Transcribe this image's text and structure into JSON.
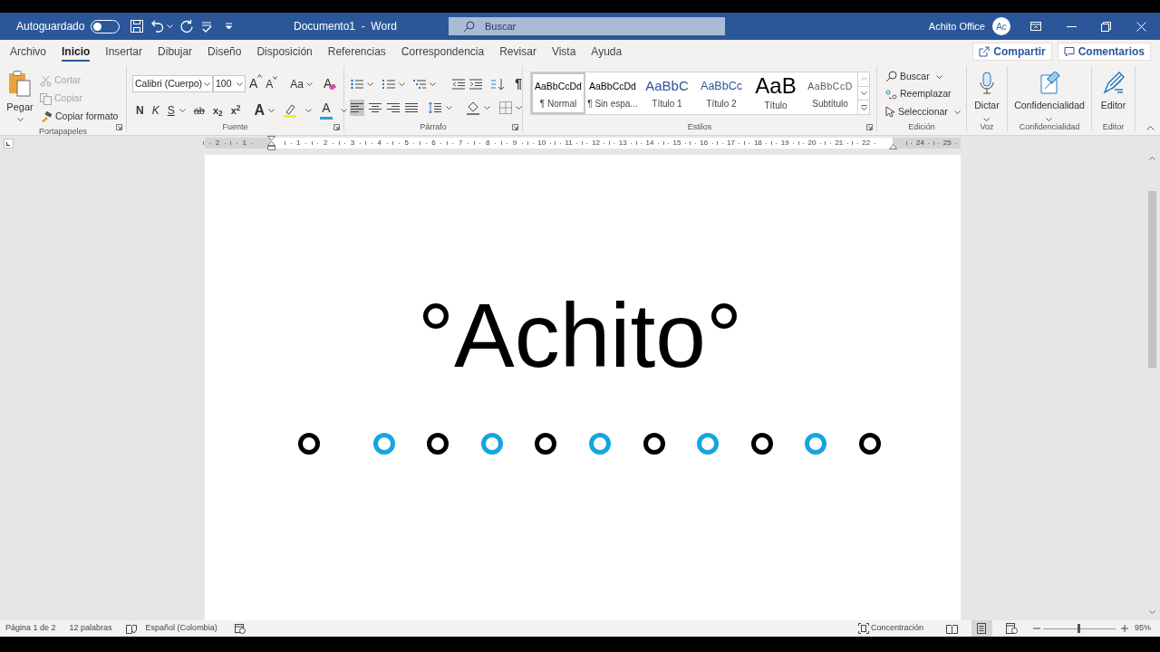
{
  "title_bar": {
    "autosave_label": "Autoguardado",
    "autosave_on": false,
    "document_title": "Documento1  -  Word",
    "search_placeholder": "Buscar",
    "user_name": "Achito Office",
    "avatar_initials": "Ac"
  },
  "menu_tabs": [
    {
      "label": "Archivo",
      "selected": false
    },
    {
      "label": "Inicio",
      "selected": true
    },
    {
      "label": "Insertar",
      "selected": false
    },
    {
      "label": "Dibujar",
      "selected": false
    },
    {
      "label": "Diseño",
      "selected": false
    },
    {
      "label": "Disposición",
      "selected": false
    },
    {
      "label": "Referencias",
      "selected": false
    },
    {
      "label": "Correspondencia",
      "selected": false
    },
    {
      "label": "Revisar",
      "selected": false
    },
    {
      "label": "Vista",
      "selected": false
    },
    {
      "label": "Ayuda",
      "selected": false
    }
  ],
  "share_button": "Compartir",
  "comments_button": "Comentarios",
  "clipboard": {
    "paste_label": "Pegar",
    "items": [
      {
        "kind": "cut",
        "label": "Cortar",
        "disabled": true
      },
      {
        "kind": "copy",
        "label": "Copiar",
        "disabled": true
      },
      {
        "kind": "format_painter",
        "label": "Copiar formato",
        "disabled": false
      }
    ],
    "group_label": "Portapapeles"
  },
  "font": {
    "font_name": "Calibri (Cuerpo)",
    "font_size": "100",
    "grow_font": "A",
    "shrink_font": "A",
    "change_case": "Aa",
    "clear_format": "A",
    "bold": "N",
    "italic": "K",
    "underline": "S",
    "strikethrough": "ab",
    "subscript": "x$_{2}$",
    "superscript": "x$^{2}$",
    "text_effects": "A",
    "font_color": "A",
    "group_label": "Fuente"
  },
  "paragraph": {
    "alignments": [
      {
        "kind": "left",
        "selected": true
      },
      {
        "kind": "center",
        "selected": false
      },
      {
        "kind": "right",
        "selected": false
      },
      {
        "kind": "justify",
        "selected": false
      }
    ],
    "pilcrow": "¶",
    "group_label": "Párrafo"
  },
  "styles": {
    "items": [
      {
        "kind": "normal",
        "preview": "AaBbCcDd",
        "label": "¶ Normal",
        "selected": true
      },
      {
        "kind": "no_spacing",
        "preview": "AaBbCcDd",
        "label": "¶ Sin espa...",
        "selected": false
      },
      {
        "kind": "heading1",
        "preview": "AaBbC",
        "label": "Título 1",
        "selected": false
      },
      {
        "kind": "heading2",
        "preview": "AaBbCc",
        "label": "Título 2",
        "selected": false
      },
      {
        "kind": "title",
        "preview": "AaB",
        "label": "Título",
        "selected": false
      },
      {
        "kind": "subtitle",
        "preview": "AaBbCcD",
        "label": "Subtítulo",
        "selected": false
      }
    ],
    "group_label": "Estilos"
  },
  "editing": {
    "items": [
      {
        "kind": "find",
        "label": "Buscar",
        "has_menu": true
      },
      {
        "kind": "replace",
        "label": "Reemplazar",
        "has_menu": false
      },
      {
        "kind": "select",
        "label": "Seleccionar",
        "has_menu": true
      }
    ],
    "group_label": "Edición"
  },
  "voice": {
    "label": "Dictar",
    "group_label": "Voz"
  },
  "sensitivity": {
    "label": "Confidencialidad",
    "group_label": "Confidencialidad"
  },
  "editor": {
    "label": "Editor",
    "group_label": "Editor"
  },
  "ruler": {
    "left_numbers": [
      "2",
      "1"
    ],
    "numbers": [
      "1",
      "2",
      "3",
      "4",
      "5",
      "6",
      "7",
      "8",
      "9",
      "10",
      "11",
      "12",
      "13",
      "14",
      "15",
      "16",
      "17",
      "18",
      "19",
      "20",
      "21",
      "22"
    ],
    "right_numbers": [
      "24",
      "25"
    ]
  },
  "document": {
    "heading": "°Achito°",
    "rings": [
      {
        "color": "#000000"
      },
      {
        "color": "#13a6df"
      },
      {
        "color": "#000000"
      },
      {
        "color": "#13a6df"
      },
      {
        "color": "#000000"
      },
      {
        "color": "#13a6df"
      },
      {
        "color": "#000000"
      },
      {
        "color": "#13a6df"
      },
      {
        "color": "#000000"
      },
      {
        "color": "#13a6df"
      },
      {
        "color": "#000000"
      }
    ]
  },
  "status_bar": {
    "page": "Página 1 de 2",
    "words": "12 palabras",
    "language": "Español (Colombia)",
    "focus": "Concentración",
    "views": [
      {
        "kind": "read",
        "selected": false
      },
      {
        "kind": "print",
        "selected": true
      },
      {
        "kind": "web",
        "selected": false
      }
    ],
    "zoom": {
      "level": 0.5,
      "reading": "95%"
    }
  }
}
